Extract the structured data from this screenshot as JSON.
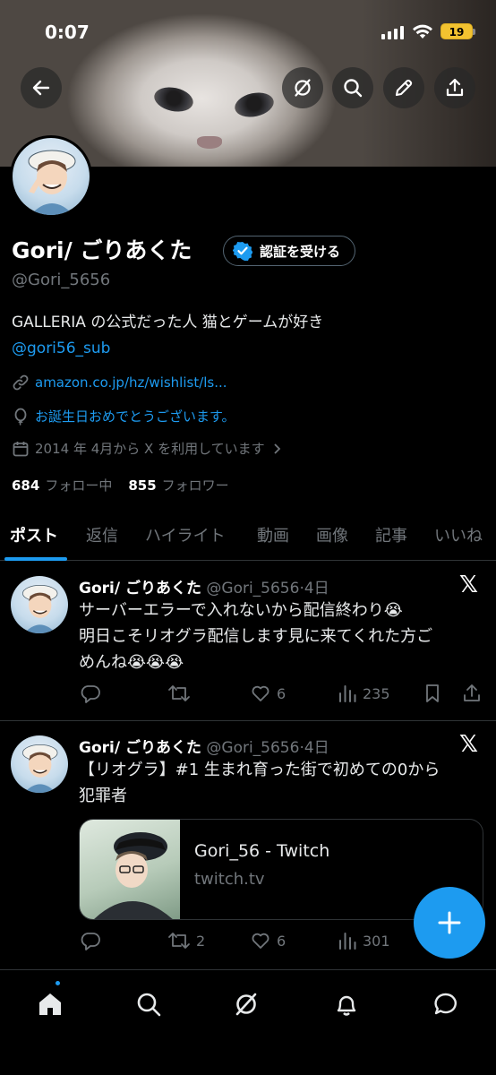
{
  "status": {
    "time": "0:07",
    "battery": "19"
  },
  "profile": {
    "name": "Gori/ ごりあくた",
    "verify_label": "認証を受ける",
    "handle": "@Gori_5656",
    "bio_line1": "GALLERIA の公式だった人 猫とゲームが好き",
    "bio_link": "@gori56_sub",
    "website": "amazon.co.jp/hz/wishlist/ls...",
    "birthday": "お誕生日おめでとうございます。",
    "joined": "2014 年 4月から X を利用しています",
    "following_count": "684",
    "following_label": "フォロー中",
    "followers_count": "855",
    "followers_label": "フォロワー"
  },
  "tabs": [
    "ポスト",
    "返信",
    "ハイライト",
    "動画",
    "画像",
    "記事",
    "いいね"
  ],
  "tweets": [
    {
      "name": "Gori/ ごりあくた",
      "handle": "@Gori_5656",
      "time": "4日",
      "line1": "サーバーエラーで入れないから配信終わり😭",
      "line2": "明日こそリオグラ配信します見に来てくれた方ご",
      "line3": "めんね😭😭😭",
      "replies": "",
      "retweets": "",
      "likes": "6",
      "views": "235"
    },
    {
      "name": "Gori/ ごりあくた",
      "handle": "@Gori_5656",
      "time": "4日",
      "line1": "【リオグラ】#1 生まれ育った街で初めての0から",
      "line2": "犯罪者",
      "card_title": "Gori_56 - Twitch",
      "card_domain": "twitch.tv",
      "replies": "",
      "retweets": "2",
      "likes": "6",
      "views": "301"
    }
  ],
  "colors": {
    "accent": "#1d9bf0",
    "muted": "#71767b",
    "bg": "#000000"
  }
}
